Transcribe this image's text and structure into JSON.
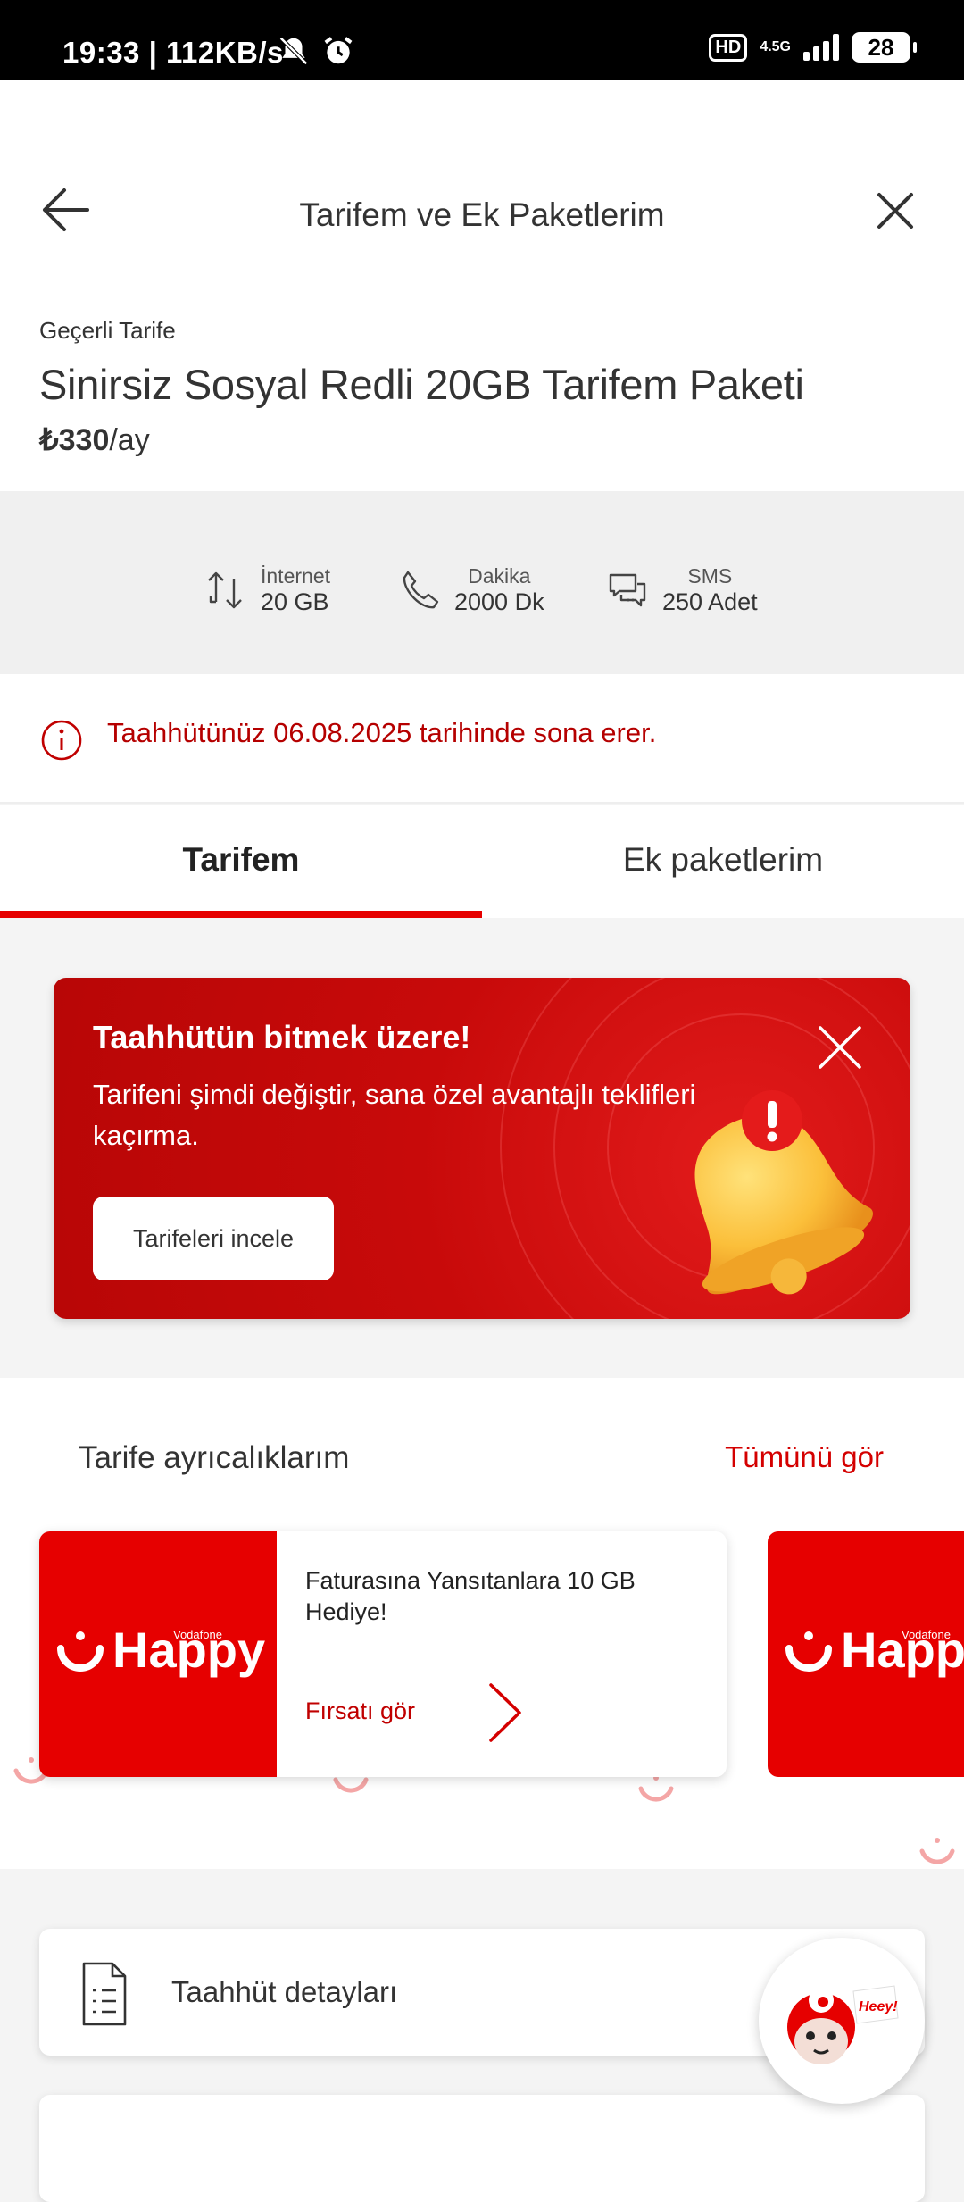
{
  "status_bar": {
    "time": "19:33",
    "speed": "112KB/s",
    "hd": "HD",
    "network": "4.5G",
    "battery": "28"
  },
  "header": {
    "title": "Tarifem ve Ek Paketlerim"
  },
  "plan": {
    "label": "Geçerli Tarife",
    "name": "Sinirsiz Sosyal Redli 20GB Tarifem Paketi",
    "price": "₺330",
    "period": "/ay"
  },
  "quotas": [
    {
      "label": "İnternet",
      "value": "20 GB",
      "icon": "data-transfer-icon"
    },
    {
      "label": "Dakika",
      "value": "2000 Dk",
      "icon": "phone-icon"
    },
    {
      "label": "SMS",
      "value": "250 Adet",
      "icon": "message-icon"
    }
  ],
  "warning": {
    "text": "Taahhütünüz 06.08.2025 tarihinde sona erer."
  },
  "tabs": [
    {
      "label": "Tarifem",
      "active": true
    },
    {
      "label": "Ek paketlerim",
      "active": false
    }
  ],
  "promo": {
    "title": "Taahhütün bitmek üzere!",
    "body": "Tarifeni şimdi değiştir, sana özel avantajlı teklifleri kaçırma.",
    "button": "Tarifeleri incele"
  },
  "privileges": {
    "title": "Tarife ayrıcalıklarım",
    "see_all": "Tümünü gör",
    "card": {
      "brand": "Happy",
      "brand_small": "Vodafone",
      "text": "Faturasına Yansıtanlara 10 GB Hediye!",
      "link": "Fırsatı gör"
    }
  },
  "details": {
    "label": "Taahhüt detayları"
  },
  "chat": {
    "bubble": "Heey!"
  },
  "colors": {
    "brand_red": "#e60000",
    "warning_red": "#b50000"
  }
}
